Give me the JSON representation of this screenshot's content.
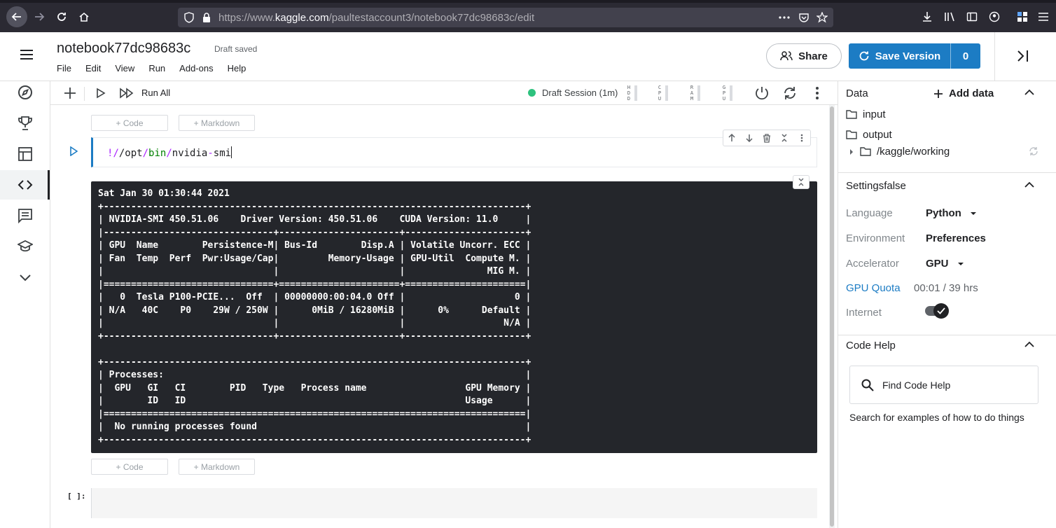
{
  "browser": {
    "url_prefix": "https://www.",
    "url_host": "kaggle.com",
    "url_path": "/paultestaccount3/notebook77dc98683c/edit"
  },
  "header": {
    "title": "notebook77dc98683c",
    "status": "Draft saved",
    "menu": [
      "File",
      "Edit",
      "View",
      "Run",
      "Add-ons",
      "Help"
    ],
    "share_label": "Share",
    "save_label": "Save Version",
    "save_count": "0"
  },
  "left_nav": {
    "icons": [
      "menu-icon",
      "compass-icon",
      "trophy-icon",
      "table-icon",
      "code-icon",
      "comments-icon",
      "school-icon",
      "chevron-down-icon"
    ],
    "active": "code-icon"
  },
  "toolbar": {
    "run_all_label": "Run All",
    "session_label": "Draft Session (1m)",
    "session_color": "#2ec27e",
    "meters": [
      "HDD",
      "CPU",
      "RAM",
      "GPU"
    ]
  },
  "notebook": {
    "add_code_label": "+ Code",
    "add_markdown_label": "+ Markdown",
    "cell1_code": {
      "bang": "!",
      "p1": "/opt",
      "sep1": "/",
      "p2": "bin",
      "sep2": "/",
      "p3": "nvidia",
      "dash": "-",
      "p4": "smi"
    },
    "output_text": "Sat Jan 30 01:30:44 2021\n+-----------------------------------------------------------------------------+\n| NVIDIA-SMI 450.51.06    Driver Version: 450.51.06    CUDA Version: 11.0     |\n|-------------------------------+----------------------+----------------------+\n| GPU  Name        Persistence-M| Bus-Id        Disp.A | Volatile Uncorr. ECC |\n| Fan  Temp  Perf  Pwr:Usage/Cap|         Memory-Usage | GPU-Util  Compute M. |\n|                               |                      |               MIG M. |\n|===============================+======================+======================|\n|   0  Tesla P100-PCIE...  Off  | 00000000:00:04.0 Off |                    0 |\n| N/A   40C    P0    29W / 250W |      0MiB / 16280MiB |      0%      Default |\n|                               |                      |                  N/A |\n+-------------------------------+----------------------+----------------------+\n\n+-----------------------------------------------------------------------------+\n| Processes:                                                                  |\n|  GPU   GI   CI        PID   Type   Process name                  GPU Memory |\n|        ID   ID                                                   Usage      |\n|=============================================================================|\n|  No running processes found                                                 |\n+-----------------------------------------------------------------------------+",
    "empty_prompt": "[ ]:"
  },
  "right_panel": {
    "data_title": "Data",
    "add_data_label": "Add data",
    "tree": [
      "input",
      "output",
      "/kaggle/working"
    ],
    "settings_title": "Settingsfalse",
    "settings": {
      "language_label": "Language",
      "language_value": "Python",
      "environment_label": "Environment",
      "environment_value": "Preferences",
      "accelerator_label": "Accelerator",
      "accelerator_value": "GPU",
      "quota_label": "GPU Quota",
      "quota_value": "00:01 / 39 hrs",
      "internet_label": "Internet"
    },
    "code_help_title": "Code Help",
    "find_help_label": "Find Code Help",
    "help_desc": "Search for examples of how to do things"
  },
  "colors": {
    "accent": "#1c7cc4",
    "output_bg": "#24262b",
    "browser_bg": "#2b2a33"
  }
}
